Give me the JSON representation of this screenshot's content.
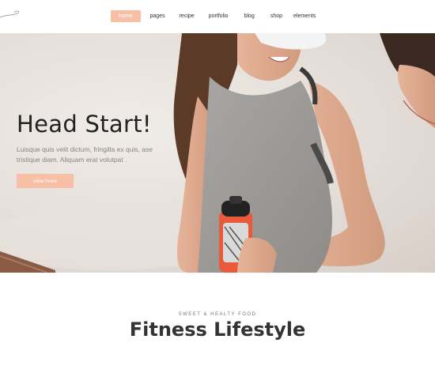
{
  "nav": {
    "items": [
      {
        "label": "home",
        "active": true
      },
      {
        "label": "pages"
      },
      {
        "label": "recipe"
      },
      {
        "label": "portfolio"
      },
      {
        "label": "blog"
      },
      {
        "label": "shop"
      },
      {
        "label": "elements"
      }
    ]
  },
  "hero": {
    "title": "Head Start!",
    "description": "Luisque quis velit dictum, fringilla ex quis, ase tristique diam. Aliquam erat volutpat .",
    "button_label": "view more"
  },
  "section": {
    "kicker": "SWEET & HEALTY FOOD",
    "title": "Fitness Lifestyle"
  },
  "colors": {
    "accent": "#f7bfa6",
    "heading": "#222222",
    "body_text": "#8a8480"
  }
}
